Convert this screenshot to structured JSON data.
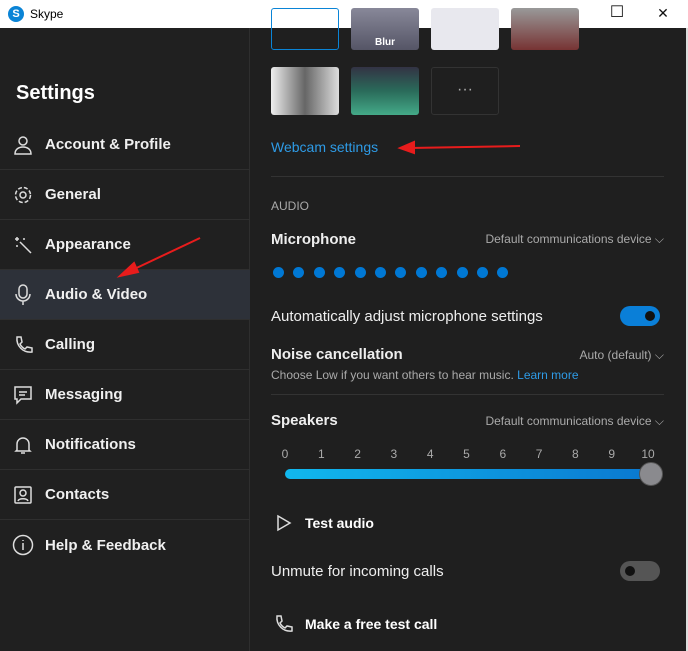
{
  "window": {
    "title": "Skype",
    "minimize": "—",
    "maximize": "☐",
    "close": "✕"
  },
  "sidebar": {
    "heading": "Settings",
    "items": [
      {
        "label": "Account & Profile",
        "icon": "person-icon"
      },
      {
        "label": "General",
        "icon": "gear-icon"
      },
      {
        "label": "Appearance",
        "icon": "magic-wand-icon"
      },
      {
        "label": "Audio & Video",
        "icon": "microphone-icon",
        "active": true
      },
      {
        "label": "Calling",
        "icon": "phone-icon"
      },
      {
        "label": "Messaging",
        "icon": "chat-icon"
      },
      {
        "label": "Notifications",
        "icon": "bell-icon"
      },
      {
        "label": "Contacts",
        "icon": "contact-card-icon"
      },
      {
        "label": "Help & Feedback",
        "icon": "info-icon"
      }
    ]
  },
  "video": {
    "blur_label": "Blur",
    "more_label": "···",
    "webcam_settings": "Webcam settings"
  },
  "audio": {
    "section": "AUDIO",
    "microphone": {
      "label": "Microphone",
      "device": "Default communications device",
      "level_dots": 12
    },
    "auto_adjust": {
      "label": "Automatically adjust microphone settings",
      "on": true
    },
    "noise": {
      "label": "Noise cancellation",
      "value": "Auto (default)",
      "hint": "Choose Low if you want others to hear music.",
      "learn_more": "Learn more"
    },
    "speakers": {
      "label": "Speakers",
      "device": "Default communications device",
      "ticks": [
        "0",
        "1",
        "2",
        "3",
        "4",
        "5",
        "6",
        "7",
        "8",
        "9",
        "10"
      ],
      "volume": 10
    },
    "test_audio": "Test audio",
    "unmute": {
      "label": "Unmute for incoming calls",
      "on": false
    },
    "test_call": "Make a free test call"
  },
  "colors": {
    "accent": "#0078d4",
    "annotation": "#e81c1c"
  }
}
